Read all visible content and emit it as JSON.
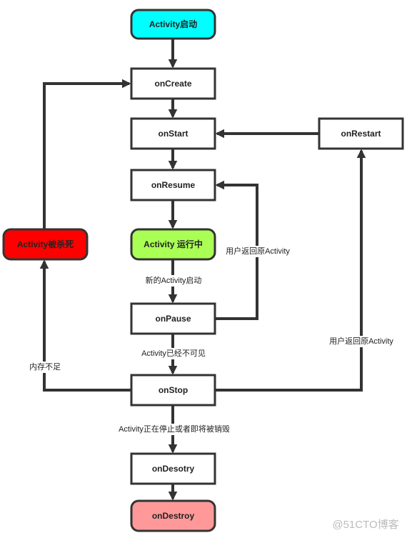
{
  "nodes": {
    "start": "Activity启动",
    "on_create": "onCreate",
    "on_start": "onStart",
    "on_resume": "onResume",
    "running": "Activity 运行中",
    "on_pause": "onPause",
    "on_stop": "onStop",
    "on_desotry": "onDesotry",
    "on_destroy": "onDestroy",
    "on_restart": "onRestart",
    "killed": "Activity被杀死"
  },
  "edges": {
    "new_activity_started": "新的Activity启动",
    "user_returns_resume": "用户返回原Activity",
    "no_longer_visible": "Activity已经不可见",
    "low_memory": "内存不足",
    "user_returns_restart": "用户返回原Activity",
    "stopping_or_destroyed": "Activity正在停止或者即将被销毁"
  },
  "colors": {
    "start": "#00ffff",
    "running": "#aaff55",
    "killed": "#ff0000",
    "on_destroy": "#ff9999",
    "default": "#ffffff"
  },
  "watermark": "@51CTO博客"
}
